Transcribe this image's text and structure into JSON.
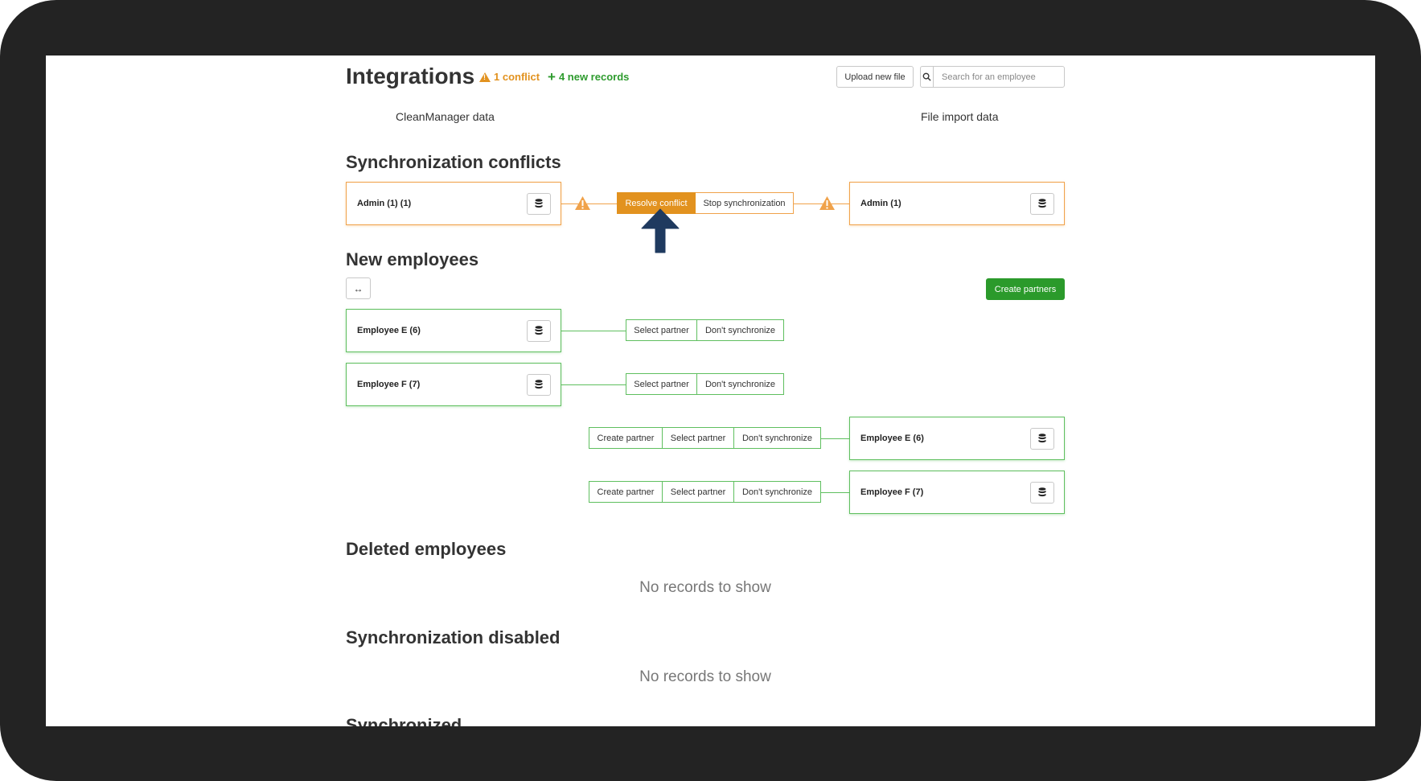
{
  "header": {
    "title": "Integrations",
    "conflict_badge": "1 conflict",
    "new_records_badge": "4 new records",
    "upload_label": "Upload new file",
    "search_placeholder": "Search for an employee"
  },
  "columns": {
    "left": "CleanManager data",
    "right": "File import data"
  },
  "conflicts": {
    "title": "Synchronization conflicts",
    "left_record": "Admin (1) (1)",
    "right_record": "Admin (1)",
    "resolve_label": "Resolve conflict",
    "stop_label": "Stop synchronization"
  },
  "new_employees": {
    "title": "New employees",
    "swap_icon_text": "↔",
    "create_partners_label": "Create partners",
    "left_rows": [
      {
        "name": "Employee E (6)",
        "select": "Select partner",
        "skip": "Don't synchronize"
      },
      {
        "name": "Employee F (7)",
        "select": "Select partner",
        "skip": "Don't synchronize"
      }
    ],
    "right_rows": [
      {
        "name": "Employee E (6)",
        "create": "Create partner",
        "select": "Select partner",
        "skip": "Don't synchronize"
      },
      {
        "name": "Employee F (7)",
        "create": "Create partner",
        "select": "Select partner",
        "skip": "Don't synchronize"
      }
    ]
  },
  "deleted": {
    "title": "Deleted employees",
    "empty": "No records to show"
  },
  "disabled": {
    "title": "Synchronization disabled",
    "empty": "No records to show"
  },
  "synchronized": {
    "title": "Synchronized"
  },
  "colors": {
    "warning": "#e2921f",
    "success": "#2b9a2b",
    "arrow": "#1f3a5f"
  }
}
